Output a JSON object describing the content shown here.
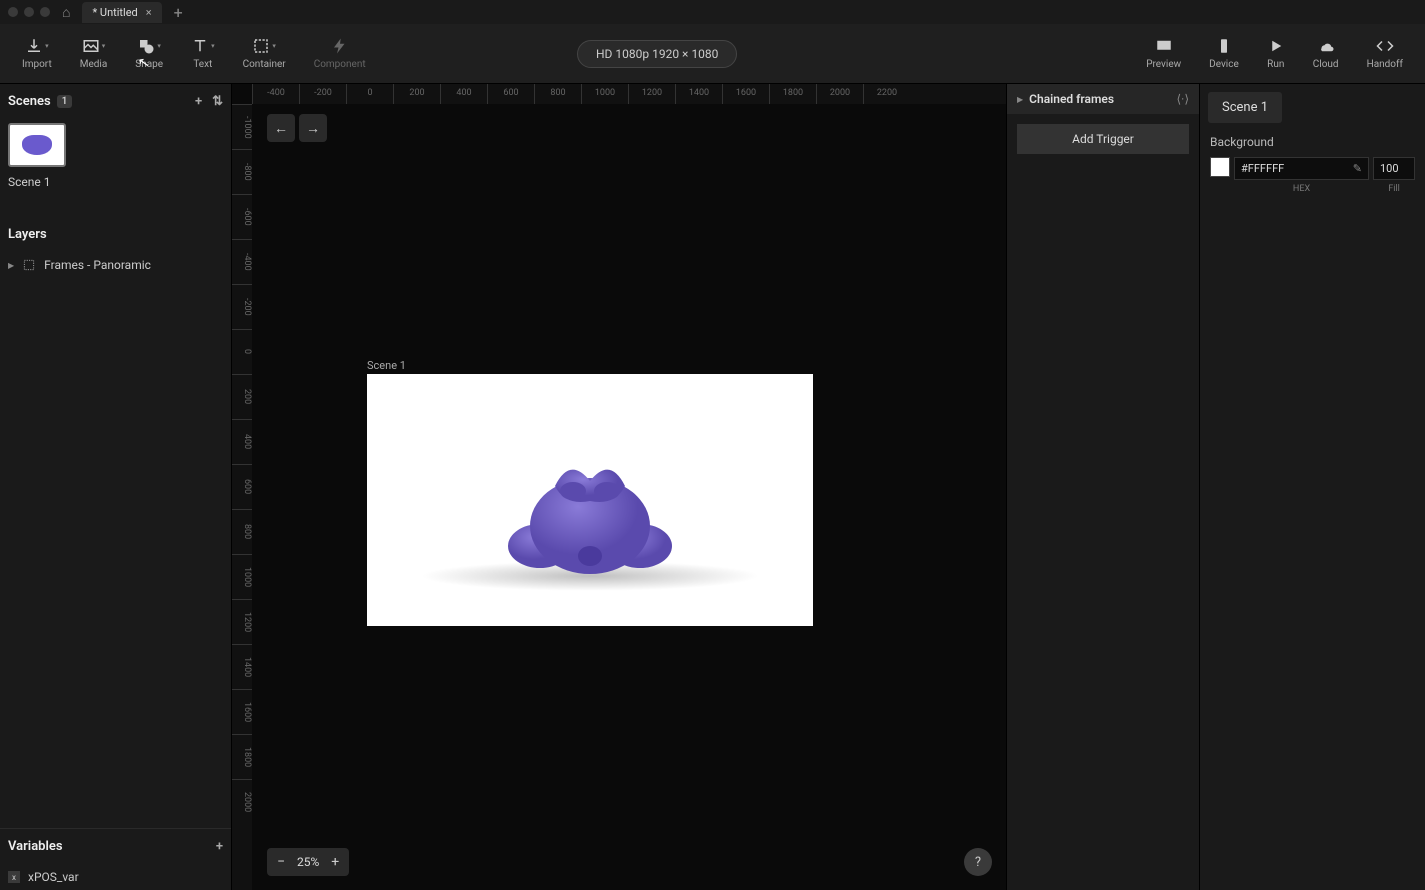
{
  "titlebar": {
    "tab_name": "* Untitled"
  },
  "toolbar": {
    "import": "Import",
    "media": "Media",
    "shape": "Shape",
    "text": "Text",
    "container": "Container",
    "component": "Component",
    "resolution": "HD 1080p  1920 × 1080",
    "preview": "Preview",
    "device": "Device",
    "run": "Run",
    "cloud": "Cloud",
    "handoff": "Handoff"
  },
  "scenes": {
    "title": "Scenes",
    "count": "1",
    "items": [
      {
        "label": "Scene 1"
      }
    ]
  },
  "layers": {
    "title": "Layers",
    "items": [
      {
        "label": "Frames - Panoramic"
      }
    ]
  },
  "variables": {
    "title": "Variables",
    "items": [
      {
        "name": "xPOS_var"
      }
    ]
  },
  "canvas": {
    "scene_label": "Scene 1",
    "zoom": "25%",
    "ruler_h": [
      "-400",
      "-200",
      "0",
      "200",
      "400",
      "600",
      "800",
      "1000",
      "1200",
      "1400",
      "1600",
      "1800",
      "2000",
      "2200"
    ],
    "ruler_v": [
      "-1000",
      "-800",
      "-600",
      "-400",
      "-200",
      "0",
      "200",
      "400",
      "600",
      "800",
      "1000",
      "1200",
      "1400",
      "1600",
      "1800",
      "2000"
    ]
  },
  "mid_panel": {
    "chain_title": "Chained frames",
    "add_trigger": "Add Trigger"
  },
  "right_panel": {
    "scene_tab": "Scene 1",
    "bg_label": "Background",
    "hex": "#FFFFFF",
    "fill": "100",
    "hex_label": "HEX",
    "fill_label": "Fill"
  }
}
